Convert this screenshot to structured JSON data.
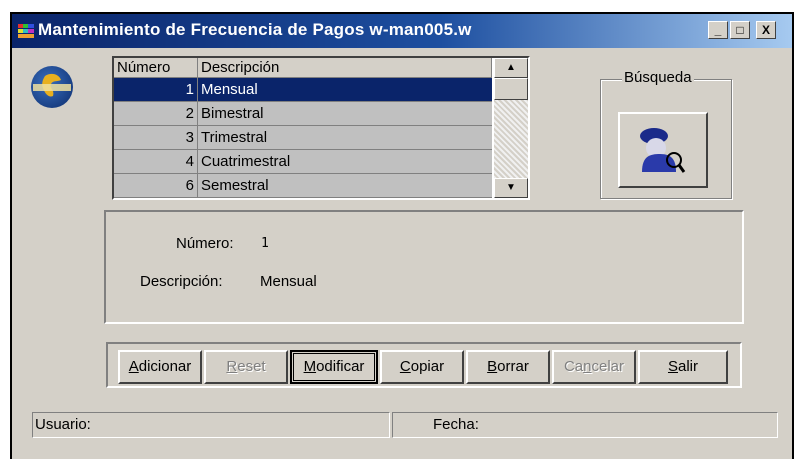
{
  "window": {
    "title": "Mantenimiento de Frecuencia de Pagos w-man005.w",
    "controls": {
      "minimize": "_",
      "maximize": "□",
      "close": "X"
    }
  },
  "logo": {
    "icon": "company-globe-logo"
  },
  "grid": {
    "columns": [
      "Número",
      "Descripción"
    ],
    "rows": [
      {
        "numero": "1",
        "descripcion": "Mensual",
        "selected": true
      },
      {
        "numero": "2",
        "descripcion": "Bimestral"
      },
      {
        "numero": "3",
        "descripcion": "Trimestral"
      },
      {
        "numero": "4",
        "descripcion": "Cuatrimestral"
      },
      {
        "numero": "6",
        "descripcion": "Semestral"
      }
    ],
    "scroll": {
      "up": "▲",
      "down": "▼"
    }
  },
  "busqueda": {
    "label": "Búsqueda",
    "icon": "detective-search-icon"
  },
  "detail": {
    "numero_label": "Número:",
    "numero_value": "1",
    "descripcion_label": "Descripción:",
    "descripcion_value": "Mensual"
  },
  "buttons": {
    "adicionar": {
      "label": "Adicionar",
      "mnemonic": "A",
      "rest": "dicionar"
    },
    "reset": {
      "label": "Reset",
      "mnemonic": "R",
      "rest": "eset",
      "disabled": true
    },
    "modificar": {
      "label": "Modificar",
      "mnemonic": "M",
      "rest": "odificar"
    },
    "copiar": {
      "label": "Copiar",
      "mnemonic": "C",
      "rest": "opiar"
    },
    "borrar": {
      "label": "Borrar",
      "mnemonic": "B",
      "rest": "orrar"
    },
    "cancelar": {
      "label": "Cancelar",
      "pre": "Ca",
      "mnemonic": "n",
      "rest": "celar",
      "disabled": true
    },
    "salir": {
      "label": "Salir",
      "mnemonic": "S",
      "rest": "alir"
    }
  },
  "status": {
    "usuario_label": "Usuario:",
    "fecha_label": "Fecha:"
  },
  "colors": {
    "titlebar_start": "#0a246a",
    "titlebar_end": "#a6caf0",
    "face": "#d4d0c8",
    "selection": "#0a246a"
  }
}
